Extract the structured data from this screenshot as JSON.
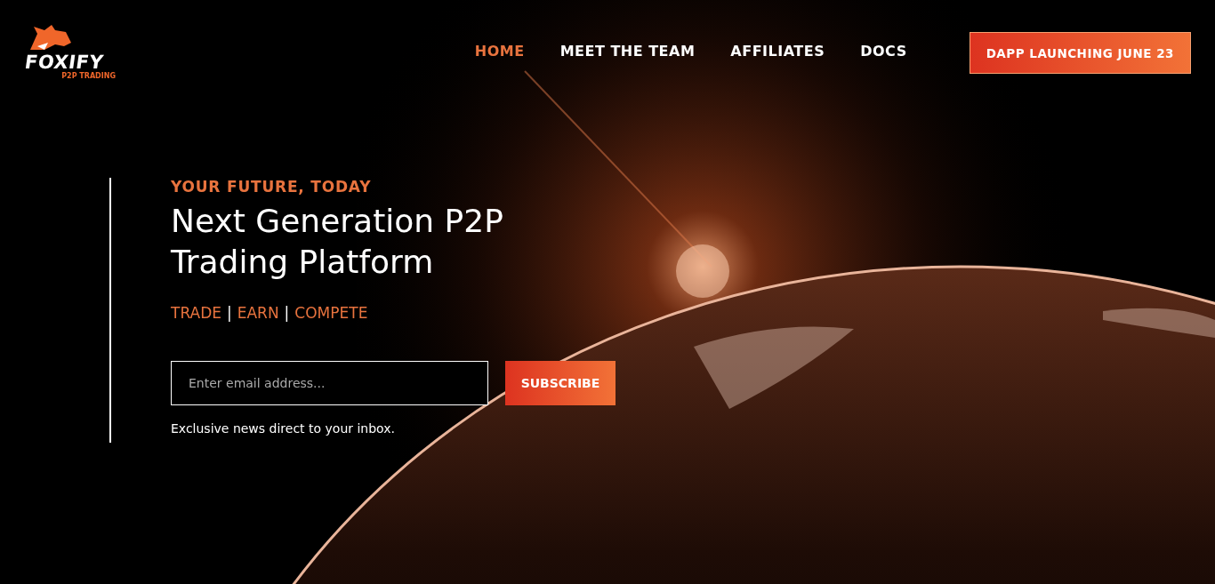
{
  "logo": {
    "name": "FOXIFY",
    "tagline": "P2P TRADING"
  },
  "nav": [
    {
      "label": "HOME",
      "selected": true
    },
    {
      "label": "MEET THE TEAM",
      "selected": false
    },
    {
      "label": "AFFILIATES",
      "selected": false
    },
    {
      "label": "DOCS",
      "selected": false
    }
  ],
  "cta_button": "DAPP LAUNCHING JUNE 23",
  "hero": {
    "eyebrow": "YOUR FUTURE, TODAY",
    "title_lines": [
      "Next Generation P2P",
      "Trading Platform"
    ],
    "tagline_words": [
      "TRADE",
      "EARN",
      "COMPETE"
    ],
    "tagline_separators": [
      "|",
      "|"
    ],
    "email": {
      "placeholder": "Enter email address..."
    },
    "subscribe_button": "SUBSCRIBE",
    "note": "Exclusive news direct to your inbox."
  }
}
